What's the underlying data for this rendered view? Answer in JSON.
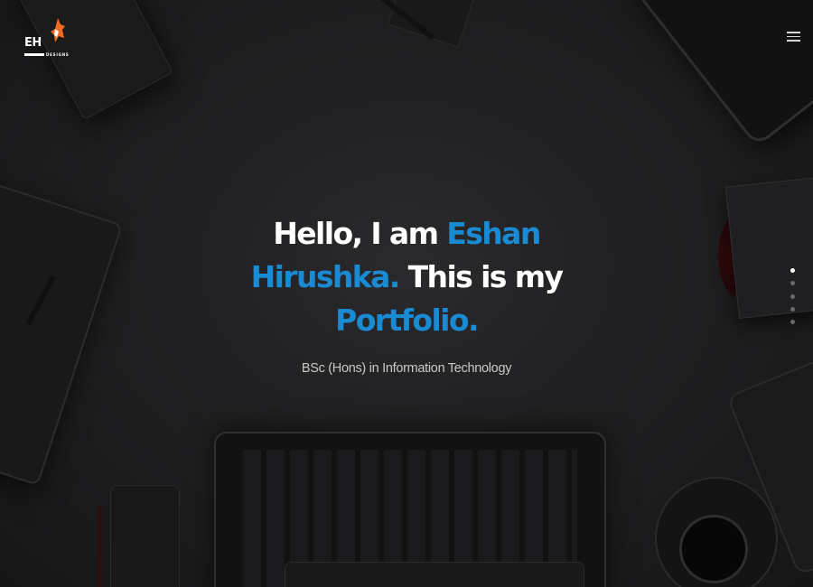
{
  "logo": {
    "initials": "EH",
    "subtext": "DESIGNS",
    "accent_color": "#f26a21"
  },
  "header": {
    "menu_icon": "hamburger-menu-icon"
  },
  "hero": {
    "line1_white": "Hello, I am ",
    "line1_blue": "Eshan",
    "line2_blue": "Hirushka.",
    "line2_white": " This is my",
    "line3_blue": "Portfolio.",
    "subtitle": "BSc (Hons) in Information Technology",
    "accent_color": "#1a8ad3",
    "text_color": "#ffffff"
  },
  "pagination": {
    "count": 5,
    "active_index": 0
  }
}
